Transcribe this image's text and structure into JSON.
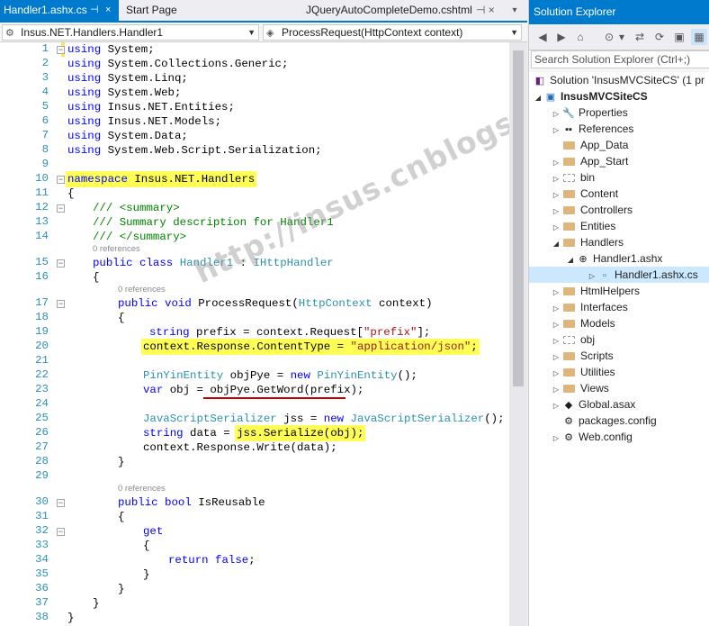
{
  "tabs": {
    "active": "Handler1.ashx.cs",
    "pin_icon": "⊣",
    "close_icon": "×",
    "start_page": "Start Page",
    "right_doc": "JQueryAutoCompleteDemo.cshtml",
    "right_pin": "⊣",
    "right_close": "×",
    "dropdown": "▾"
  },
  "navbar": {
    "left": "Insus.NET.Handlers.Handler1",
    "right": "ProcessRequest(HttpContext context)"
  },
  "code": {
    "line_numbers": [
      "1",
      "2",
      "3",
      "4",
      "5",
      "6",
      "7",
      "8",
      "9",
      "10",
      "11",
      "12",
      "13",
      "14",
      "15",
      "16",
      "17",
      "18",
      "19",
      "20",
      "21",
      "22",
      "23",
      "24",
      "25",
      "26",
      "27",
      "28",
      "29",
      "30",
      "31",
      "32",
      "33",
      "34",
      "35",
      "36",
      "37",
      "38"
    ],
    "refs": {
      "r1": "0 references",
      "r2": "0 references",
      "r3": "0 references"
    },
    "t": {
      "using": "using",
      "u1": " System;",
      "u2": " System.Collections.Generic;",
      "u3": " System.Linq;",
      "u4": " System.Web;",
      "u5": " Insus.NET.Entities;",
      "u6": " Insus.NET.Models;",
      "u7": " System.Data;",
      "u8": " System.Web.Script.Serialization;",
      "namespace": "namespace",
      "ns_name": " Insus.NET.Handlers",
      "lbrace": "{",
      "rbrace": "}",
      "doc1": "/// <summary>",
      "doc2": "/// Summary description for Handler1",
      "doc3": "/// </summary>",
      "public": "public",
      "class": " class ",
      "handler1": "Handler1",
      "colon": " : ",
      "ihttp": "IHttpHandler",
      "void": " void ",
      "process": "ProcessRequest(",
      "httpctx": "HttpContext",
      "ctxparam": " context)",
      "string": "string",
      "prefix_decl": " prefix = context.Request[",
      "prefix_str": "\"prefix\"",
      "close_br": "];",
      "ct_a": "context.Response.ContentType = ",
      "ct_str": "\"application/json\"",
      "semi": ";",
      "pyentity": "PinYinEntity",
      "objpye": " objPye = ",
      "new": "new",
      "pyentity2": " PinYinEntity",
      "parens": "();",
      "var": "var",
      "obj_eq": " obj = ",
      "getword": "objPye.GetWord(prefix);",
      "jss_type": "JavaScriptSerializer",
      "jss_eq": " jss = ",
      "jss_new": " JavaScriptSerializer",
      "data_eq": " data = ",
      "serialize": "jss.Serialize(obj);",
      "write": "context.Response.Write(data);",
      "bool": " bool ",
      "isreusable": "IsReusable",
      "get": "get",
      "return": "return",
      "false": " false",
      "ret_semi": ";"
    }
  },
  "watermark": "http://insus.cnblogs.com",
  "solution_explorer": {
    "title": "Solution Explorer",
    "search_placeholder": "Search Solution Explorer (Ctrl+;)",
    "toolbar_icons": [
      "◀",
      "▶",
      "⌂",
      "⊙",
      "▾",
      "⇄",
      "⟳",
      "▣",
      "▦"
    ],
    "items": [
      {
        "label": "Solution 'InsusMVCSiteCS' (1 pr",
        "icon": "solution-icon"
      },
      {
        "label": "InsusMVCSiteCS",
        "icon": "project-icon"
      },
      {
        "label": "Properties",
        "icon": "wrench-icon"
      },
      {
        "label": "References",
        "icon": "references-icon"
      },
      {
        "label": "App_Data",
        "icon": "folder-icon"
      },
      {
        "label": "App_Start",
        "icon": "folder-icon"
      },
      {
        "label": "bin",
        "icon": "folder-dashed-icon"
      },
      {
        "label": "Content",
        "icon": "folder-icon"
      },
      {
        "label": "Controllers",
        "icon": "folder-icon"
      },
      {
        "label": "Entities",
        "icon": "folder-icon"
      },
      {
        "label": "Handlers",
        "icon": "folder-icon"
      },
      {
        "label": "Handler1.ashx",
        "icon": "web-handler-icon"
      },
      {
        "label": "Handler1.ashx.cs",
        "icon": "csharp-file-icon"
      },
      {
        "label": "HtmlHelpers",
        "icon": "folder-icon"
      },
      {
        "label": "Interfaces",
        "icon": "folder-icon"
      },
      {
        "label": "Models",
        "icon": "folder-icon"
      },
      {
        "label": "obj",
        "icon": "folder-dashed-icon"
      },
      {
        "label": "Scripts",
        "icon": "folder-icon"
      },
      {
        "label": "Utilities",
        "icon": "folder-icon"
      },
      {
        "label": "Views",
        "icon": "folder-icon"
      },
      {
        "label": "Global.asax",
        "icon": "global-asax-icon"
      },
      {
        "label": "packages.config",
        "icon": "config-file-icon"
      },
      {
        "label": "Web.config",
        "icon": "config-file-icon"
      }
    ]
  }
}
